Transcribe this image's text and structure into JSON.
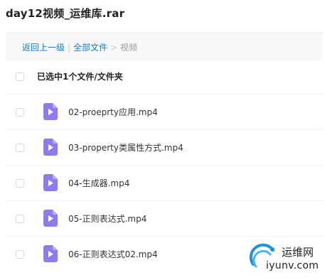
{
  "title": "day12视频_运维库.rar",
  "breadcrumb": {
    "back": "返回上一级",
    "separator_1": "|",
    "all_files": "全部文件",
    "separator_2": ">",
    "current": "视频"
  },
  "selection_summary": "已选中1个文件/文件夹",
  "files": [
    {
      "name": "02-proeprty应用.mp4",
      "icon": "video-file-icon"
    },
    {
      "name": "03-property类属性方式.mp4",
      "icon": "video-file-icon"
    },
    {
      "name": "04-生成器.mp4",
      "icon": "video-file-icon"
    },
    {
      "name": "05-正则表达式.mp4",
      "icon": "video-file-icon"
    },
    {
      "name": "06-正则表达式02.mp4",
      "icon": "video-file-icon"
    }
  ],
  "watermark": {
    "name": "运维网",
    "domain": "iyunv.com"
  },
  "colors": {
    "link": "#0f7fd6",
    "icon_purple": "#8c7cf0",
    "breadcrumb_bg": "#f7f8fa"
  }
}
